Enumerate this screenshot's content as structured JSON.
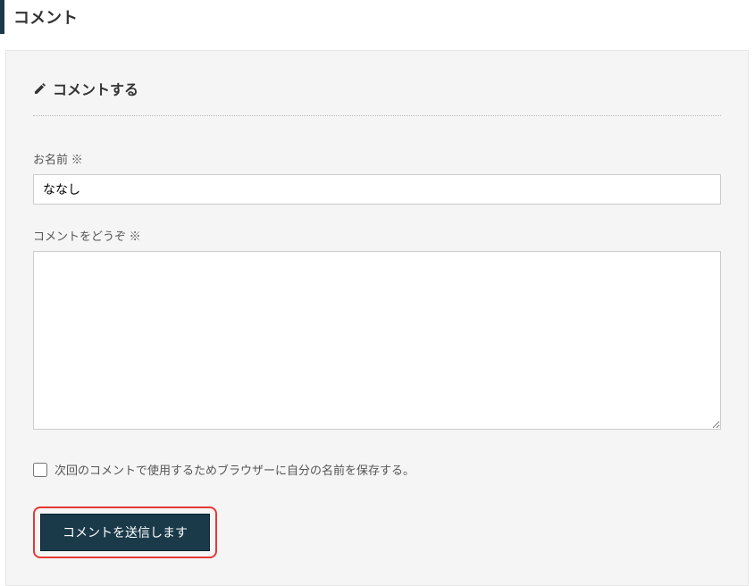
{
  "header": {
    "title": "コメント"
  },
  "form": {
    "heading": "コメントする",
    "name_label": "お名前 ※",
    "name_value": "ななし",
    "comment_label": "コメントをどうぞ ※",
    "comment_value": "",
    "save_name_label": "次回のコメントで使用するためブラウザーに自分の名前を保存する。",
    "submit_label": "コメントを送信します"
  }
}
